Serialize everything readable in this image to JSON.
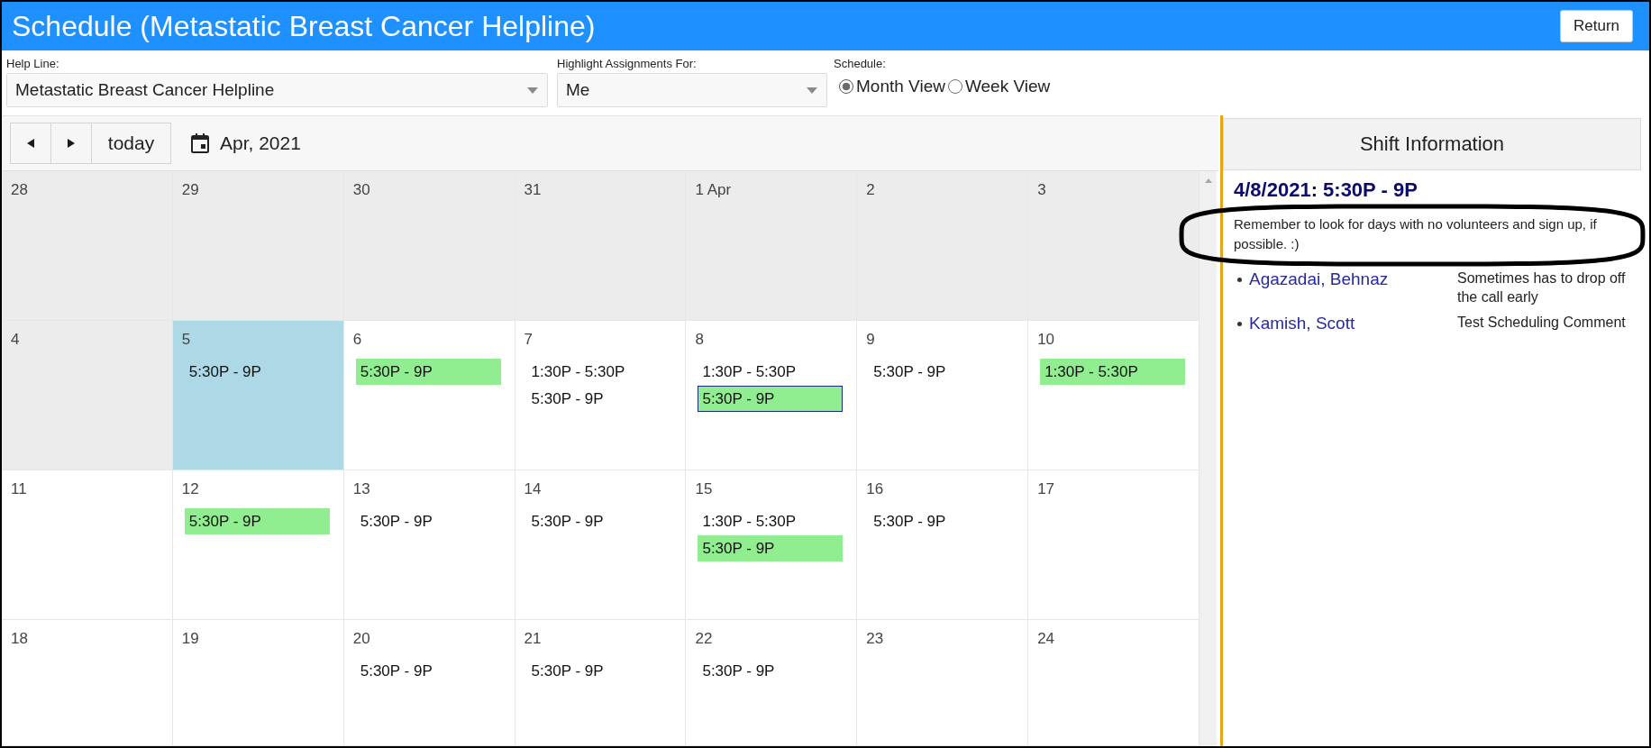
{
  "header": {
    "title": "Schedule (Metastatic Breast Cancer Helpline)",
    "return_button": "Return"
  },
  "filters": {
    "help_line": {
      "label": "Help Line:",
      "value": "Metastatic Breast Cancer Helpline"
    },
    "highlight_for": {
      "label": "Highlight Assignments For:",
      "value": "Me"
    },
    "schedule": {
      "label": "Schedule:",
      "options": [
        {
          "label": "Month View",
          "selected": true
        },
        {
          "label": "Week View",
          "selected": false
        }
      ]
    }
  },
  "calendar": {
    "today_button": "today",
    "title": "Apr, 2021",
    "weeks": [
      {
        "days": [
          {
            "day": "28",
            "past": true,
            "today": false
          },
          {
            "day": "29",
            "past": true,
            "today": false
          },
          {
            "day": "30",
            "past": true,
            "today": false
          },
          {
            "day": "31",
            "past": true,
            "today": false
          },
          {
            "day": "1 Apr",
            "past": true,
            "today": false
          },
          {
            "day": "2",
            "past": true,
            "today": false
          },
          {
            "day": "3",
            "past": true,
            "today": false
          }
        ]
      },
      {
        "days": [
          {
            "day": "4",
            "past": true,
            "today": false
          },
          {
            "day": "5",
            "past": false,
            "today": true,
            "events": [
              {
                "time": "5:30P - 9P",
                "highlighted": false,
                "selected": false
              }
            ]
          },
          {
            "day": "6",
            "past": false,
            "today": false,
            "events": [
              {
                "time": "5:30P - 9P",
                "highlighted": true,
                "selected": false
              }
            ]
          },
          {
            "day": "7",
            "past": false,
            "today": false,
            "events": [
              {
                "time": "1:30P - 5:30P",
                "highlighted": false,
                "selected": false
              },
              {
                "time": "5:30P - 9P",
                "highlighted": false,
                "selected": false
              }
            ]
          },
          {
            "day": "8",
            "past": false,
            "today": false,
            "events": [
              {
                "time": "1:30P - 5:30P",
                "highlighted": false,
                "selected": false
              },
              {
                "time": "5:30P - 9P",
                "highlighted": true,
                "selected": true
              }
            ]
          },
          {
            "day": "9",
            "past": false,
            "today": false,
            "events": [
              {
                "time": "5:30P - 9P",
                "highlighted": false,
                "selected": false
              }
            ]
          },
          {
            "day": "10",
            "past": false,
            "today": false,
            "events": [
              {
                "time": "1:30P - 5:30P",
                "highlighted": true,
                "selected": false
              }
            ]
          }
        ]
      },
      {
        "days": [
          {
            "day": "11",
            "past": false,
            "today": false
          },
          {
            "day": "12",
            "past": false,
            "today": false,
            "events": [
              {
                "time": "5:30P - 9P",
                "highlighted": true,
                "selected": false
              }
            ]
          },
          {
            "day": "13",
            "past": false,
            "today": false,
            "events": [
              {
                "time": "5:30P - 9P",
                "highlighted": false,
                "selected": false
              }
            ]
          },
          {
            "day": "14",
            "past": false,
            "today": false,
            "events": [
              {
                "time": "5:30P - 9P",
                "highlighted": false,
                "selected": false
              }
            ]
          },
          {
            "day": "15",
            "past": false,
            "today": false,
            "events": [
              {
                "time": "1:30P - 5:30P",
                "highlighted": false,
                "selected": false
              },
              {
                "time": "5:30P - 9P",
                "highlighted": true,
                "selected": false
              }
            ]
          },
          {
            "day": "16",
            "past": false,
            "today": false,
            "events": [
              {
                "time": "5:30P - 9P",
                "highlighted": false,
                "selected": false
              }
            ]
          },
          {
            "day": "17",
            "past": false,
            "today": false
          }
        ]
      },
      {
        "days": [
          {
            "day": "18",
            "past": false,
            "today": false
          },
          {
            "day": "19",
            "past": false,
            "today": false
          },
          {
            "day": "20",
            "past": false,
            "today": false,
            "events": [
              {
                "time": "5:30P - 9P",
                "highlighted": false,
                "selected": false
              }
            ]
          },
          {
            "day": "21",
            "past": false,
            "today": false,
            "events": [
              {
                "time": "5:30P - 9P",
                "highlighted": false,
                "selected": false
              }
            ]
          },
          {
            "day": "22",
            "past": false,
            "today": false,
            "events": [
              {
                "time": "5:30P - 9P",
                "highlighted": false,
                "selected": false
              }
            ]
          },
          {
            "day": "23",
            "past": false,
            "today": false
          },
          {
            "day": "24",
            "past": false,
            "today": false
          }
        ]
      }
    ]
  },
  "shift_panel": {
    "title": "Shift Information",
    "heading": "4/8/2021: 5:30P - 9P",
    "note": "Remember to look for days with no volunteers and sign up, if possible. :)",
    "volunteers": [
      {
        "name": "Agazadai, Behnaz",
        "comment": "Sometimes has to drop off the call early"
      },
      {
        "name": "Kamish, Scott",
        "comment": "Test Scheduling Comment"
      }
    ]
  }
}
